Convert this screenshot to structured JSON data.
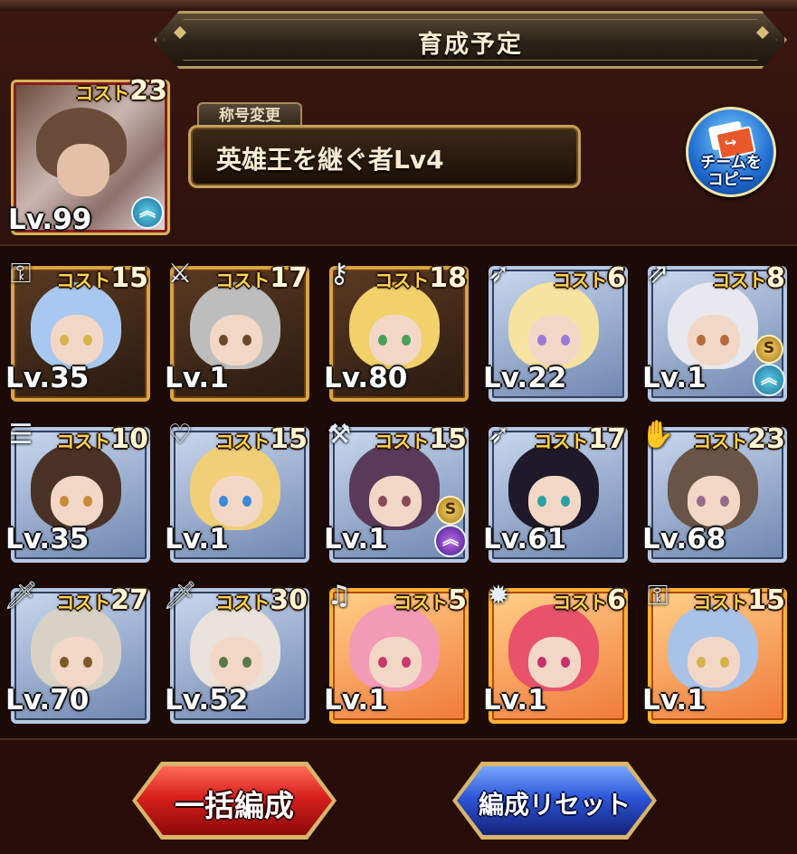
{
  "header": {
    "title": "育成予定"
  },
  "leader": {
    "cost_label": "コスト",
    "cost": "23",
    "level": "Lv.99",
    "badges": [
      "up-arrow-icon"
    ]
  },
  "title_change": {
    "tab_label": "称号変更",
    "current_title": "英雄王を継ぐ者Lv4"
  },
  "copy_team": {
    "label_line1": "チームを",
    "label_line2": "コピー"
  },
  "units": [
    {
      "cost_label": "コスト",
      "cost": "15",
      "level": "Lv.35",
      "weapon_icon": "lantern-icon",
      "frame": "gold",
      "hair_color": "#a9c8ef",
      "eye_color": "#d6b24a"
    },
    {
      "cost_label": "コスト",
      "cost": "17",
      "level": "Lv.1",
      "weapon_icon": "dagger-icon",
      "frame": "gold",
      "hair_color": "#bdbdbd",
      "eye_color": "#6b4a2a"
    },
    {
      "cost_label": "コスト",
      "cost": "18",
      "level": "Lv.80",
      "weapon_icon": "key-icon",
      "frame": "gold",
      "hair_color": "#f2d06a",
      "eye_color": "#4aa05a"
    },
    {
      "cost_label": "コスト",
      "cost": "6",
      "level": "Lv.22",
      "weapon_icon": "spear-icon",
      "frame": "silver",
      "hair_color": "#f7e3a0",
      "eye_color": "#9a7ad8"
    },
    {
      "cost_label": "コスト",
      "cost": "8",
      "level": "Lv.1",
      "weapon_icon": "lance-icon",
      "frame": "silver",
      "hair_color": "#e8e8ee",
      "eye_color": "#b56a3a",
      "badges": [
        "s-rank-icon",
        "up-arrow-icon"
      ]
    },
    {
      "cost_label": "コスト",
      "cost": "10",
      "level": "Lv.35",
      "weapon_icon": "book-icon",
      "frame": "silver",
      "hair_color": "#4a3226",
      "eye_color": "#c98a3a"
    },
    {
      "cost_label": "コスト",
      "cost": "15",
      "level": "Lv.1",
      "weapon_icon": "heart-staff-icon",
      "frame": "silver",
      "hair_color": "#f0cf78",
      "eye_color": "#3a8ad8"
    },
    {
      "cost_label": "コスト",
      "cost": "15",
      "level": "Lv.1",
      "weapon_icon": "axe-icon",
      "frame": "silver",
      "hair_color": "#5a3a5a",
      "eye_color": "#8a4a5a",
      "badges": [
        "s-rank-icon",
        "up-arrow-purple-icon"
      ]
    },
    {
      "cost_label": "コスト",
      "cost": "17",
      "level": "Lv.61",
      "weapon_icon": "spear-icon",
      "frame": "silver",
      "hair_color": "#1e1a2a",
      "eye_color": "#2aa0a0"
    },
    {
      "cost_label": "コスト",
      "cost": "23",
      "level": "Lv.68",
      "weapon_icon": "gauntlet-icon",
      "frame": "silver",
      "hair_color": "#6a5446",
      "eye_color": "#9a6a8a"
    },
    {
      "cost_label": "コスト",
      "cost": "27",
      "level": "Lv.70",
      "weapon_icon": "sword-icon",
      "frame": "silver",
      "hair_color": "#d8d2c6",
      "eye_color": "#7a5a2a"
    },
    {
      "cost_label": "コスト",
      "cost": "30",
      "level": "Lv.52",
      "weapon_icon": "sword-icon",
      "frame": "silver",
      "hair_color": "#e8e2da",
      "eye_color": "#5a7a4a"
    },
    {
      "cost_label": "コスト",
      "cost": "5",
      "level": "Lv.1",
      "weapon_icon": "shoes-icon",
      "frame": "orange",
      "hair_color": "#f39ab6",
      "eye_color": "#c83a6a"
    },
    {
      "cost_label": "コスト",
      "cost": "6",
      "level": "Lv.1",
      "weapon_icon": "sun-emblem-icon",
      "frame": "orange",
      "hair_color": "#e8526a",
      "eye_color": "#c8306a"
    },
    {
      "cost_label": "コスト",
      "cost": "15",
      "level": "Lv.1",
      "weapon_icon": "lantern-icon",
      "frame": "orange",
      "hair_color": "#a9c2e8",
      "eye_color": "#d6b24a"
    }
  ],
  "buttons": {
    "bulk_form": "一括編成",
    "reset_form": "編成リセット"
  },
  "colors": {
    "cost_label": "#ffd64a",
    "panel_bg": "#2a0f0b",
    "frame_gold": "#d9a544",
    "frame_silver": "#b9c9e3",
    "frame_orange": "#ffb238"
  }
}
